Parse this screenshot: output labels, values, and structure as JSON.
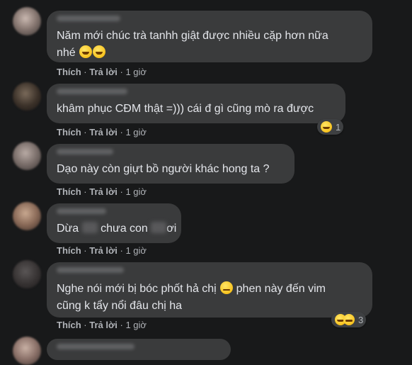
{
  "actions": {
    "like": "Thích",
    "reply": "Trả lời",
    "sep": "·",
    "time": "1 giờ"
  },
  "comments": [
    {
      "line1": "Năm mới chúc trà tanhh giật được nhiều cặp hơn nữa",
      "line2": "nhé",
      "reactions": null
    },
    {
      "line1": "khâm phục CĐM thật =))) cái đ gì cũng mò ra được",
      "line2": "",
      "reactions": {
        "count": "1"
      }
    },
    {
      "line1": "Dạo này còn giựt bồ người khác hong ta ?",
      "line2": "",
      "reactions": null
    },
    {
      "part1": "Dừa",
      "part2": "chưa con",
      "part3": "ơi",
      "reactions": null
    },
    {
      "line1a": "Nghe nói mới bị bóc phốt hả chị",
      "line1b": "phen này đến vim",
      "line2": "cũng k tẩy nổi đâu chị ha",
      "reactions": {
        "count": "3"
      }
    }
  ]
}
